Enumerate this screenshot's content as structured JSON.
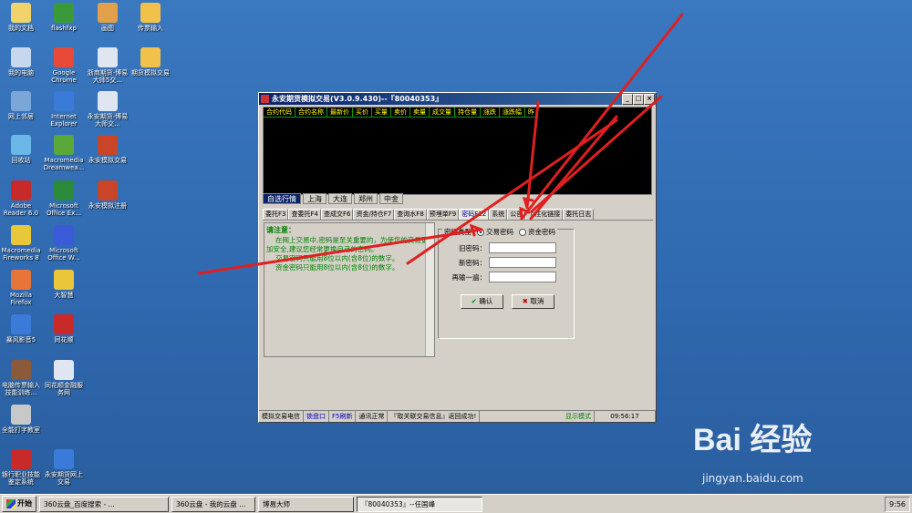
{
  "desktop_icons": [
    {
      "label": "我的文档",
      "color": "#f2d36b",
      "col": 0,
      "row": 0
    },
    {
      "label": "flashfxp",
      "color": "#3a9a3a",
      "col": 1,
      "row": 0
    },
    {
      "label": "画图",
      "color": "#e2a04a",
      "col": 2,
      "row": 0
    },
    {
      "label": "传票输入",
      "color": "#f2c14a",
      "col": 3,
      "row": 0
    },
    {
      "label": "我的电脑",
      "color": "#c7d8ee",
      "col": 0,
      "row": 1
    },
    {
      "label": "Google Chrome",
      "color": "#e84a3a",
      "col": 1,
      "row": 1
    },
    {
      "label": "浙商期货-博易大师5交...",
      "color": "#dfe6f2",
      "col": 2,
      "row": 1
    },
    {
      "label": "期货模拟交易",
      "color": "#f2c14a",
      "col": 3,
      "row": 1
    },
    {
      "label": "网上邻居",
      "color": "#7aa7d8",
      "col": 0,
      "row": 2
    },
    {
      "label": "Internet Explorer",
      "color": "#3a7ad8",
      "col": 1,
      "row": 2
    },
    {
      "label": "永安期货-博易大师交...",
      "color": "#dfe6f2",
      "col": 2,
      "row": 2
    },
    {
      "label": "回收站",
      "color": "#6ab7e8",
      "col": 0,
      "row": 3
    },
    {
      "label": "Macromedia Dreamwea...",
      "color": "#5aa83a",
      "col": 1,
      "row": 3
    },
    {
      "label": "永安模拟交易",
      "color": "#c8452a",
      "col": 2,
      "row": 3
    },
    {
      "label": "Adobe Reader 6.0",
      "color": "#c82a2a",
      "col": 0,
      "row": 4
    },
    {
      "label": "Microsoft Office Ex...",
      "color": "#2a8a3a",
      "col": 1,
      "row": 4
    },
    {
      "label": "永安模拟注册",
      "color": "#c8452a",
      "col": 2,
      "row": 4
    },
    {
      "label": "Macromedia Fireworks 8",
      "color": "#e8c83a",
      "col": 0,
      "row": 5
    },
    {
      "label": "Microsoft Office W...",
      "color": "#3a5ad8",
      "col": 1,
      "row": 5
    },
    {
      "label": "Mozilla Firefox",
      "color": "#e8743a",
      "col": 0,
      "row": 6
    },
    {
      "label": "大智慧",
      "color": "#e8c83a",
      "col": 1,
      "row": 6
    },
    {
      "label": "暴风影音5",
      "color": "#3a7ad8",
      "col": 0,
      "row": 7
    },
    {
      "label": "同花顺",
      "color": "#c82a2a",
      "col": 1,
      "row": 7
    },
    {
      "label": "电脑传票输入技能训练...",
      "color": "#8a5a3a",
      "col": 0,
      "row": 8
    },
    {
      "label": "同花顺金融服务网",
      "color": "#dfe6f2",
      "col": 1,
      "row": 8
    },
    {
      "label": "全能打字教室",
      "color": "#c8c8c8",
      "col": 0,
      "row": 9
    },
    {
      "label": "银行职业技能鉴定系统",
      "color": "#c82a2a",
      "col": 0,
      "row": 10
    },
    {
      "label": "永安期货网上交易",
      "color": "#3a7ad8",
      "col": 1,
      "row": 10
    }
  ],
  "window": {
    "title": "永安期货模拟交易(V3.0.9.430)--『80040353』",
    "min": "_",
    "max": "□",
    "close": "×"
  },
  "quote_headers": [
    "合约代码",
    "合约名称",
    "最新价",
    "买价",
    "买量",
    "卖价",
    "卖量",
    "成交量",
    "持仓量",
    "涨跌",
    "涨跌幅",
    "昨"
  ],
  "market_tabs": [
    "自选行情",
    "上海",
    "大连",
    "郑州",
    "中金"
  ],
  "func_tabs": [
    "委托F3",
    "查委托F4",
    "查成交F6",
    "资金/持仓F7",
    "查询水F8",
    "预埋单F9",
    "密码F12",
    "系统",
    "公告",
    "个性化链接",
    "委托日志"
  ],
  "notice": {
    "heading": "请注意：",
    "lines": [
      "在网上交易中,密码是至关重要的，为使您的交易更加安全,建议您经常更换自己的密码。",
      "交易密码只能用8位以内(含8位)的数字。",
      "资金密码只能用8位以内(含8位)的数字。"
    ]
  },
  "password_form": {
    "type_label": "密码类型",
    "opt_trade": "交易密码",
    "opt_fund": "资金密码",
    "old_label": "旧密码：",
    "new_label": "新密码：",
    "confirm_label": "再输一遍：",
    "ok": "确认",
    "cancel": "取消"
  },
  "status": [
    "模拟交易电信",
    "锁盘口",
    "F5刷新",
    "通讯正常",
    "『取关联交易信息』返回成功!",
    "显示模式",
    "09:56:17"
  ],
  "watermark": {
    "brand": "Bai 经验",
    "url": "jingyan.baidu.com"
  },
  "taskbar": {
    "start": "开始",
    "tasks": [
      "360云盘_百度搜索 - ...",
      "360云盘 - 我的云盘 ...",
      "博易大师",
      "『80040353』--任国峰"
    ],
    "clock": "9:56"
  },
  "colors": {
    "arrow": "#e02020",
    "title_bar": "#0a246a",
    "quote_header_text": "#ffff00",
    "notice_text": "#008000"
  }
}
